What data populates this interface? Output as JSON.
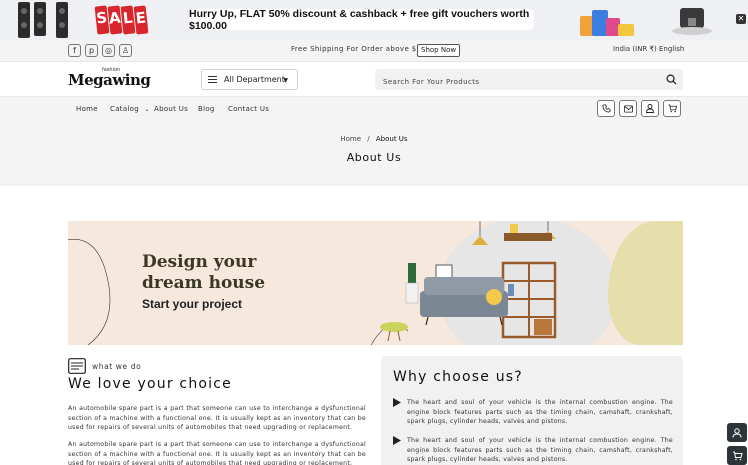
{
  "promo": {
    "sale_letters": [
      "S",
      "A",
      "L",
      "E"
    ],
    "message": "Hurry Up, FLAT 50% discount & cashback + free gift vouchers worth $100.00",
    "close_glyph": "✕"
  },
  "topbar": {
    "socials": [
      {
        "icon": "facebook-icon",
        "glyph": "f"
      },
      {
        "icon": "pinterest-icon",
        "glyph": "p"
      },
      {
        "icon": "instagram-icon",
        "glyph": "◎"
      },
      {
        "icon": "snapchat-icon",
        "glyph": "♙"
      }
    ],
    "shipping_text": "Free Shipping For Order above $200.00",
    "shop_now_label": "Shop Now",
    "locale": "India (INR ₹)",
    "language": "English"
  },
  "header": {
    "logo_text": "Megawing",
    "logo_sub": "fashion",
    "department_label": "All Department",
    "search_placeholder": "Search For Your Products"
  },
  "nav": {
    "items": [
      {
        "label": "Home"
      },
      {
        "label": "Catalog"
      },
      {
        "label": "About Us"
      },
      {
        "label": "Blog"
      },
      {
        "label": "Contact Us"
      }
    ],
    "icons": [
      "phone-icon",
      "mail-icon",
      "user-icon",
      "cart-icon"
    ]
  },
  "breadcrumb": {
    "home": "Home",
    "separator": "/",
    "current": "About Us",
    "title": "About Us"
  },
  "hero": {
    "headline_line1": "Design your",
    "headline_line2": "dream house",
    "tagline": "Start your project"
  },
  "about": {
    "kicker": "what we do",
    "heading": "We love your choice",
    "paragraphs": [
      "An automobile spare part is a part that someone can use to interchange a dysfunctional section of a machine with a functional one. It is usually kept as an inventory that can be used for repairs of several units of automobiles that need upgrading or replacement.",
      "An automobile spare part is a part that someone can use to interchange a dysfunctional section of a machine with a functional one. It is usually kept as an inventory that can be used for repairs of several units of automobiles that need upgrading or replacement."
    ]
  },
  "why": {
    "title": "Why choose us?",
    "points": [
      "The heart and soul of your vehicle is the internal combustion engine. The engine block features parts such as the timing chain, camshaft, crankshaft, spark plugs, cylinder heads, valves and pistons.",
      "The heart and soul of your vehicle is the internal combustion engine. The engine block features parts such as the timing chain, camshaft, crankshaft, spark plugs, cylinder heads, valves and pistons."
    ]
  },
  "colors": {
    "accent": "#2d3539",
    "sale_red": "#d9262c",
    "hero_bg": "#f6e8dc"
  }
}
